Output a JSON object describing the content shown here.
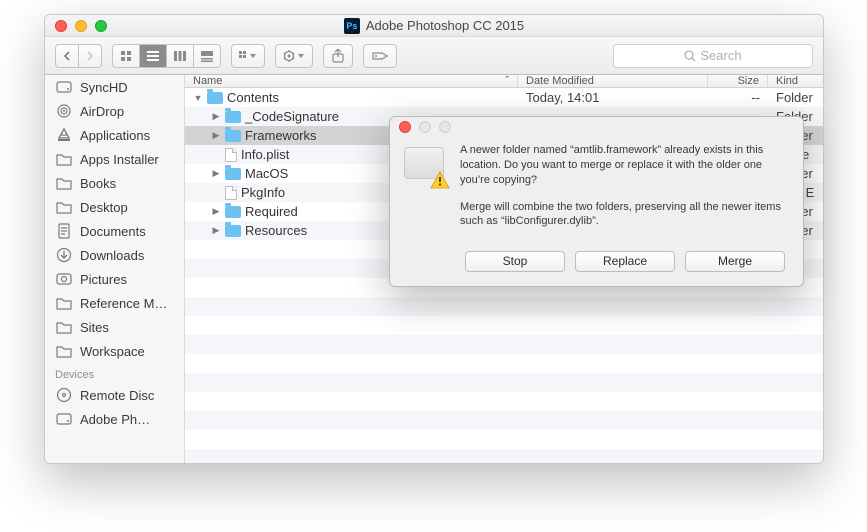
{
  "window_title": "Adobe Photoshop CC 2015",
  "search_placeholder": "Search",
  "sidebar": {
    "devices_label": "Devices",
    "items_top": [
      {
        "label": "SyncHD",
        "icon": "hdd"
      },
      {
        "label": "AirDrop",
        "icon": "airdrop"
      },
      {
        "label": "Applications",
        "icon": "apps"
      },
      {
        "label": "Apps Installer",
        "icon": "folder"
      },
      {
        "label": "Books",
        "icon": "folder"
      },
      {
        "label": "Desktop",
        "icon": "folder"
      },
      {
        "label": "Documents",
        "icon": "docs"
      },
      {
        "label": "Downloads",
        "icon": "downloads"
      },
      {
        "label": "Pictures",
        "icon": "pictures"
      },
      {
        "label": "Reference M…",
        "icon": "folder"
      },
      {
        "label": "Sites",
        "icon": "folder"
      },
      {
        "label": "Workspace",
        "icon": "folder"
      }
    ],
    "items_devices": [
      {
        "label": "Remote Disc",
        "icon": "disc"
      },
      {
        "label": "Adobe Ph…",
        "icon": "hdd"
      }
    ]
  },
  "columns": {
    "name": "Name",
    "date": "Date Modified",
    "size": "Size",
    "kind": "Kind"
  },
  "files": [
    {
      "depth": 0,
      "name": "Contents",
      "type": "folder",
      "expanded": true,
      "date": "Today, 14:01",
      "size": "--",
      "kind": "Folder",
      "selected": false
    },
    {
      "depth": 1,
      "name": "_CodeSignature",
      "type": "folder",
      "expanded": false,
      "date": "",
      "size": "",
      "kind": "Folder",
      "selected": false
    },
    {
      "depth": 1,
      "name": "Frameworks",
      "type": "folder",
      "expanded": false,
      "date": "",
      "size": "",
      "kind": "Folder",
      "selected": true
    },
    {
      "depth": 1,
      "name": "Info.plist",
      "type": "file",
      "expanded": null,
      "date": "",
      "size": "",
      "kind": "prope",
      "selected": false
    },
    {
      "depth": 1,
      "name": "MacOS",
      "type": "folder",
      "expanded": false,
      "date": "",
      "size": "",
      "kind": "Folder",
      "selected": false
    },
    {
      "depth": 1,
      "name": "PkgInfo",
      "type": "file",
      "expanded": null,
      "date": "",
      "size": "",
      "kind": "Unix E",
      "selected": false
    },
    {
      "depth": 1,
      "name": "Required",
      "type": "folder",
      "expanded": false,
      "date": "",
      "size": "",
      "kind": "Folder",
      "selected": false
    },
    {
      "depth": 1,
      "name": "Resources",
      "type": "folder",
      "expanded": false,
      "date": "",
      "size": "",
      "kind": "Folder",
      "selected": false
    }
  ],
  "dialog": {
    "msg1": "A newer folder named “amtlib.framework” already exists in this location. Do you want to merge or replace it with the older one you’re copying?",
    "msg2": "Merge will combine the two folders, preserving all the newer items such as “libConfigurer.dylib”.",
    "btn_stop": "Stop",
    "btn_replace": "Replace",
    "btn_merge": "Merge"
  }
}
